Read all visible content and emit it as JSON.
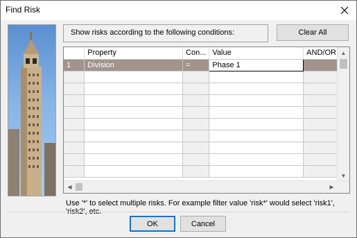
{
  "window": {
    "title": "Find Risk"
  },
  "conditions_label": "Show risks according to the following conditions:",
  "buttons": {
    "clear_all": "Clear All",
    "ok": "OK",
    "cancel": "Cancel"
  },
  "grid": {
    "columns": [
      "Property",
      "Con...",
      "Value",
      "AND/OR"
    ],
    "rows": [
      {
        "num": "1",
        "property": "Division",
        "condition": "=",
        "value": "Phase 1",
        "andor": ""
      }
    ],
    "empty_rows": 9
  },
  "hint": "Use '*' to select multiple risks. For example filter value 'risk*' would select 'risk1', 'risk2', etc."
}
